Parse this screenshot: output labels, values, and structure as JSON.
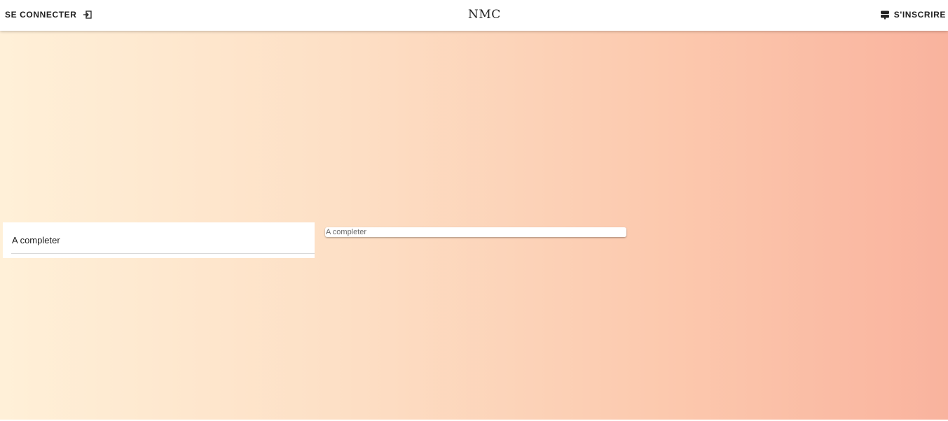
{
  "header": {
    "login_label": "SE CONNECTER",
    "login_icon": "login-arrow-icon",
    "logo_text": "NMC",
    "signup_label": "S'INSCRIRE",
    "signup_icon": "signpost-icon"
  },
  "main": {
    "card_label": "A completer",
    "input_placeholder": "A completer",
    "input_value": ""
  },
  "colors": {
    "gradient_start": "#fff0d8",
    "gradient_end": "#f9b39e",
    "header_bg": "#ffffff"
  }
}
